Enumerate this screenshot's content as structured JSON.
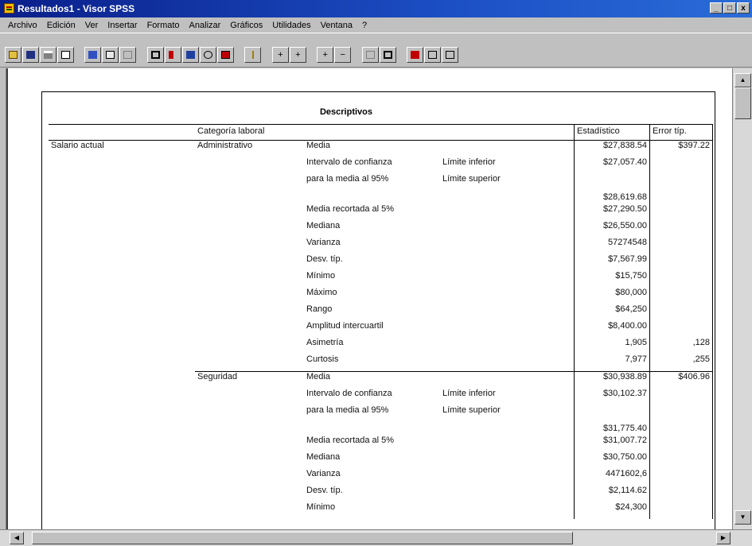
{
  "window": {
    "title": "Resultados1 - Visor SPSS",
    "buttons": [
      "_",
      "□",
      "x"
    ]
  },
  "menu": [
    "Archivo",
    "Edición",
    "Ver",
    "Insertar",
    "Formato",
    "Analizar",
    "Gráficos",
    "Utilidades",
    "Ventana",
    "?"
  ],
  "toolbar": {
    "icons": [
      "open-icon",
      "save-icon",
      "print-icon",
      "print-preview-icon",
      "export-icon",
      "dialog-recall-icon",
      "undo-icon",
      "goto-data-icon",
      "goto-case-icon",
      "variables-icon",
      "use-sets-icon",
      "select-cases-icon",
      "info-icon",
      "promote-icon",
      "demote-icon",
      "expand-icon",
      "collapse-icon",
      "show-icon",
      "hide-icon",
      "insert-heading-icon",
      "insert-title-icon",
      "insert-text-icon"
    ]
  },
  "pivot": {
    "title": "Descriptivos",
    "headers": {
      "category": "Categoría laboral",
      "statistic": "Estadístico",
      "error": "Error típ."
    },
    "variable": "Salario actual",
    "groups": [
      {
        "category": "Administrativo",
        "rows": [
          {
            "stat": "Media",
            "sub": "",
            "value": "$27,838.54",
            "error": "$397.22"
          },
          {
            "stat": "Intervalo de confianza",
            "sub": "Límite inferior",
            "value": "$27,057.40",
            "error": ""
          },
          {
            "stat": "para la media al 95%",
            "sub": "Límite superior",
            "value": "$28,619.68",
            "error": ""
          },
          {
            "stat": "Media recortada al 5%",
            "sub": "",
            "value": "$27,290.50",
            "error": ""
          },
          {
            "stat": "Mediana",
            "sub": "",
            "value": "$26,550.00",
            "error": ""
          },
          {
            "stat": "Varianza",
            "sub": "",
            "value": "57274548",
            "error": ""
          },
          {
            "stat": "Desv. típ.",
            "sub": "",
            "value": "$7,567.99",
            "error": ""
          },
          {
            "stat": "Mínimo",
            "sub": "",
            "value": "$15,750",
            "error": ""
          },
          {
            "stat": "Máximo",
            "sub": "",
            "value": "$80,000",
            "error": ""
          },
          {
            "stat": "Rango",
            "sub": "",
            "value": "$64,250",
            "error": ""
          },
          {
            "stat": "Amplitud intercuartil",
            "sub": "",
            "value": "$8,400.00",
            "error": ""
          },
          {
            "stat": "Asimetría",
            "sub": "",
            "value": "1,905",
            "error": ",128"
          },
          {
            "stat": "Curtosis",
            "sub": "",
            "value": "7,977",
            "error": ",255"
          }
        ]
      },
      {
        "category": "Seguridad",
        "rows": [
          {
            "stat": "Media",
            "sub": "",
            "value": "$30,938.89",
            "error": "$406.96"
          },
          {
            "stat": "Intervalo de confianza",
            "sub": "Límite inferior",
            "value": "$30,102.37",
            "error": ""
          },
          {
            "stat": "para la media al 95%",
            "sub": "Límite superior",
            "value": "$31,775.40",
            "error": ""
          },
          {
            "stat": "Media recortada al 5%",
            "sub": "",
            "value": "$31,007.72",
            "error": ""
          },
          {
            "stat": "Mediana",
            "sub": "",
            "value": "$30,750.00",
            "error": ""
          },
          {
            "stat": "Varianza",
            "sub": "",
            "value": "4471602,6",
            "error": ""
          },
          {
            "stat": "Desv. típ.",
            "sub": "",
            "value": "$2,114.62",
            "error": ""
          },
          {
            "stat": "Mínimo",
            "sub": "",
            "value": "$24,300",
            "error": ""
          }
        ]
      }
    ]
  }
}
